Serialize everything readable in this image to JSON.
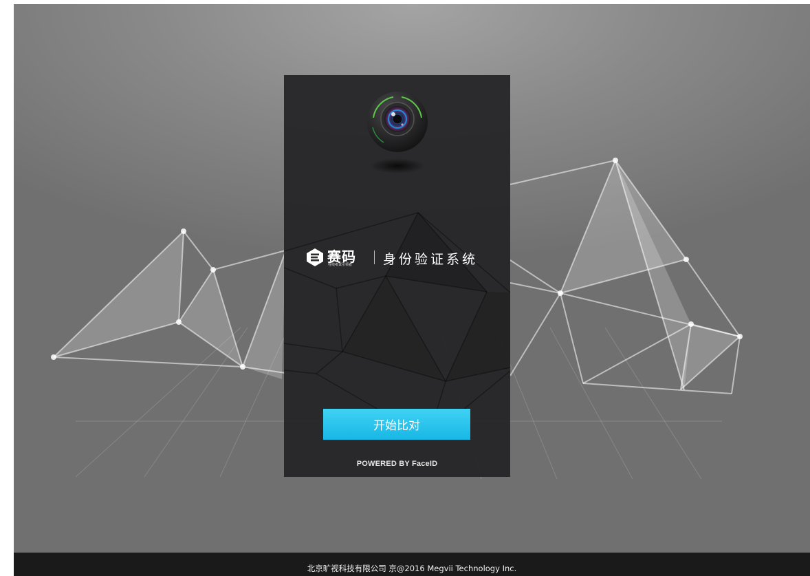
{
  "brand": {
    "name": "赛码",
    "tagline": "在线考试引领者",
    "system_title": "身份验证系统",
    "logo_icon": "saima-logo-icon",
    "illustration": "camera-icon"
  },
  "actions": {
    "start_label": "开始比对"
  },
  "panel": {
    "powered_by": "POWERED BY FaceID"
  },
  "footer": {
    "text": "北京旷视科技有限公司 京@2016 Megvii Technology Inc."
  },
  "colors": {
    "accent": "#21c1ec",
    "panel": "#242426",
    "footer": "#1a1a1a",
    "background": "#8a8a8a"
  }
}
